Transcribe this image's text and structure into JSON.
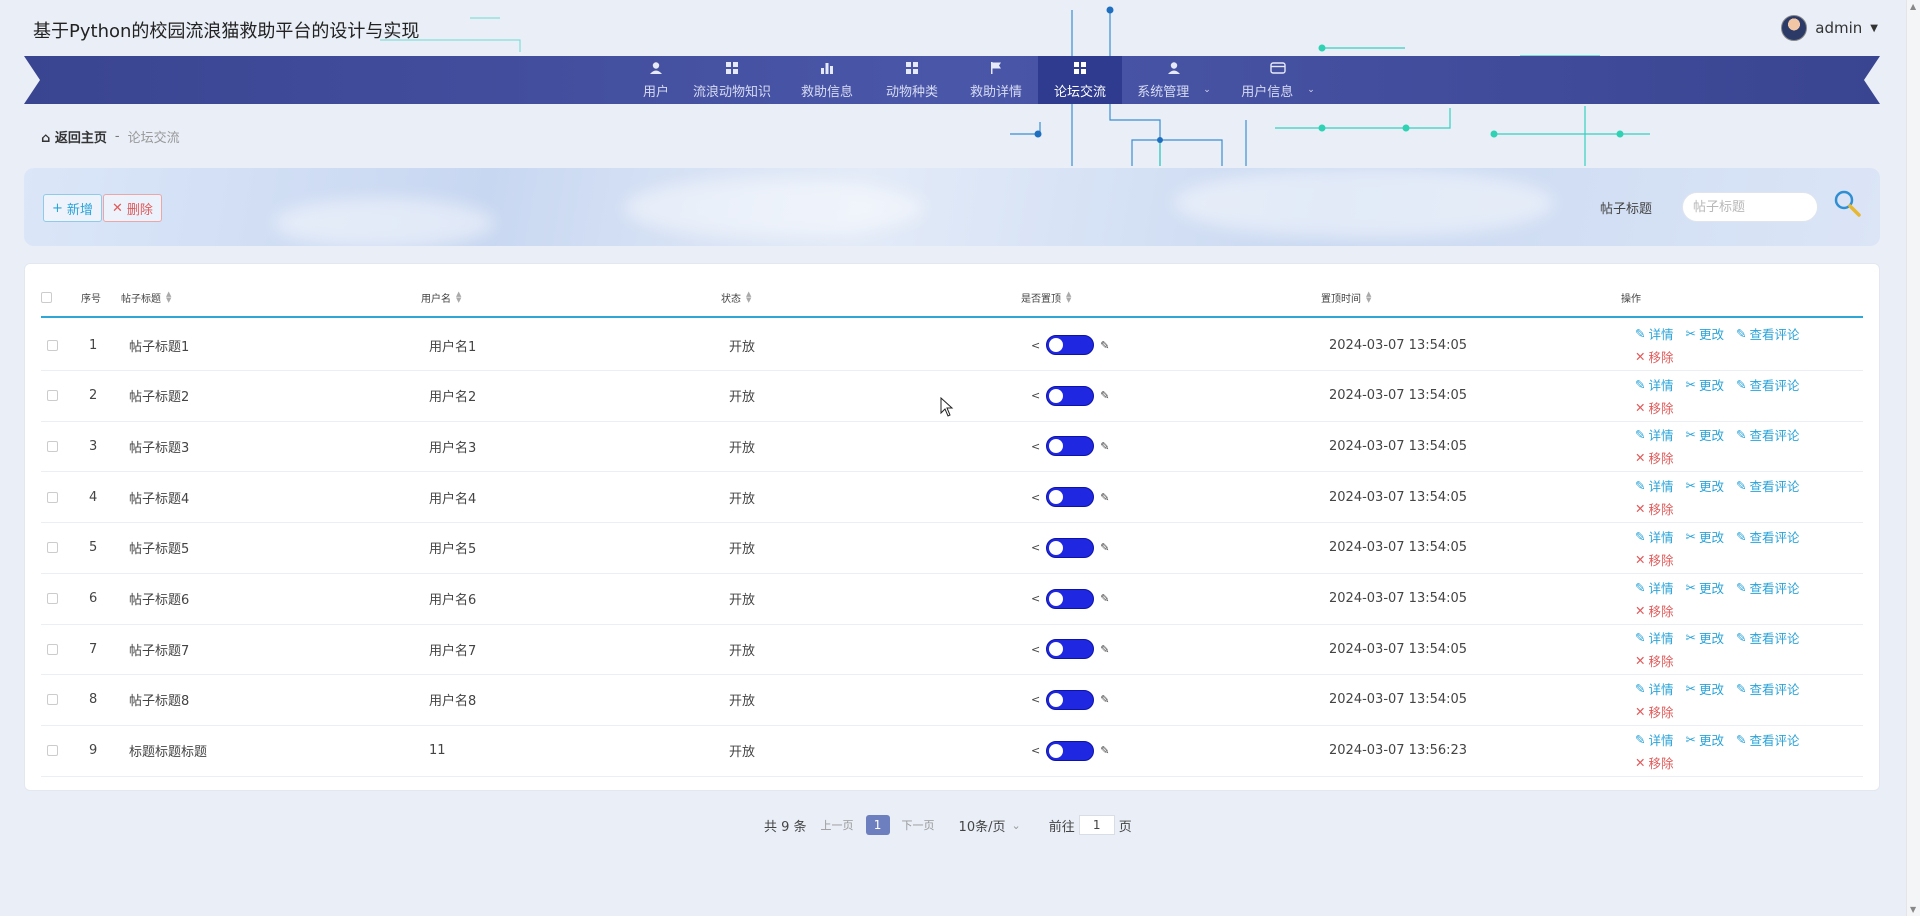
{
  "header": {
    "title": "基于Python的校园流浪猫救助平台的设计与实现",
    "username": "admin"
  },
  "nav": {
    "items": [
      {
        "label": "用户",
        "icon": "user-icon"
      },
      {
        "label": "流浪动物知识",
        "icon": "grid-icon"
      },
      {
        "label": "救助信息",
        "icon": "bar-chart-icon"
      },
      {
        "label": "动物种类",
        "icon": "grid-icon"
      },
      {
        "label": "救助详情",
        "icon": "flag-icon"
      },
      {
        "label": "论坛交流",
        "icon": "grid-icon",
        "active": true
      },
      {
        "label": "系统管理",
        "icon": "user-icon",
        "dropdown": true
      },
      {
        "label": "用户信息",
        "icon": "card-icon",
        "dropdown": true
      }
    ]
  },
  "breadcrumb": {
    "home": "返回主页",
    "sep": "-",
    "current": "论坛交流"
  },
  "toolbar": {
    "add_label": "新增",
    "delete_label": "删除",
    "search_label": "帖子标题",
    "search_placeholder": "帖子标题"
  },
  "table": {
    "columns": [
      "序号",
      "帖子标题",
      "用户名",
      "状态",
      "是否置顶",
      "置顶时间",
      "操作"
    ],
    "rows": [
      {
        "index": "1",
        "title": "帖子标题1",
        "user": "用户名1",
        "status": "开放",
        "time": "2024-03-07 13:54:05"
      },
      {
        "index": "2",
        "title": "帖子标题2",
        "user": "用户名2",
        "status": "开放",
        "time": "2024-03-07 13:54:05"
      },
      {
        "index": "3",
        "title": "帖子标题3",
        "user": "用户名3",
        "status": "开放",
        "time": "2024-03-07 13:54:05"
      },
      {
        "index": "4",
        "title": "帖子标题4",
        "user": "用户名4",
        "status": "开放",
        "time": "2024-03-07 13:54:05"
      },
      {
        "index": "5",
        "title": "帖子标题5",
        "user": "用户名5",
        "status": "开放",
        "time": "2024-03-07 13:54:05"
      },
      {
        "index": "6",
        "title": "帖子标题6",
        "user": "用户名6",
        "status": "开放",
        "time": "2024-03-07 13:54:05"
      },
      {
        "index": "7",
        "title": "帖子标题7",
        "user": "用户名7",
        "status": "开放",
        "time": "2024-03-07 13:54:05"
      },
      {
        "index": "8",
        "title": "帖子标题8",
        "user": "用户名8",
        "status": "开放",
        "time": "2024-03-07 13:54:05"
      },
      {
        "index": "9",
        "title": "标题标题标题",
        "user": "11",
        "status": "开放",
        "time": "2024-03-07 13:56:23"
      }
    ],
    "actions": {
      "detail": "详情",
      "edit": "更改",
      "comments": "查看评论",
      "remove": "移除"
    }
  },
  "pagination": {
    "total": "共 9 条",
    "prev": "上一页",
    "current": "1",
    "next": "下一页",
    "page_size": "10条/页",
    "goto_prefix": "前往",
    "goto_value": "1",
    "goto_suffix": "页"
  },
  "colors": {
    "nav_bg": "#3a4591",
    "nav_active": "#2e3b8f",
    "accent": "#2fa6d6",
    "switch": "#1f27e0",
    "danger": "#e05a5a"
  }
}
